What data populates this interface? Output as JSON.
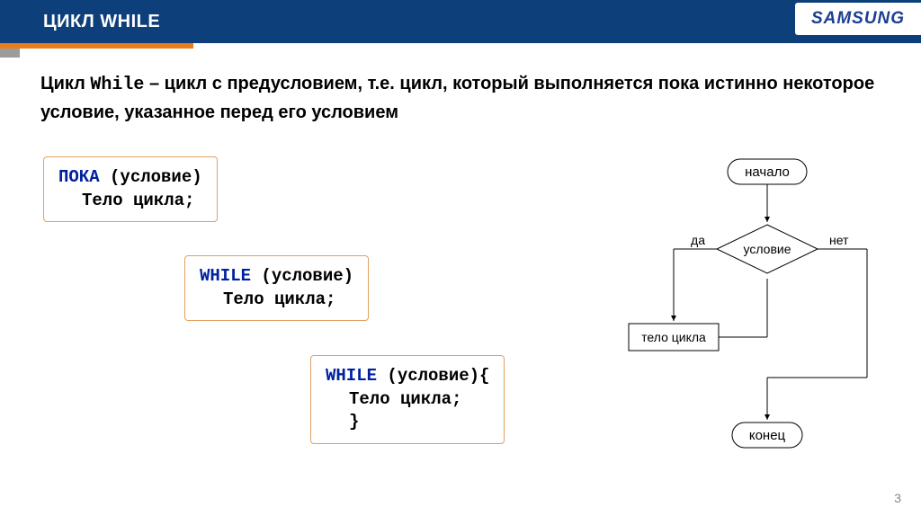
{
  "header": {
    "title": "ЦИКЛ WHILE",
    "brand": "SAMSUNG"
  },
  "description": {
    "prefix": "Цикл ",
    "mono": "While",
    "rest": " – цикл с предусловием, т.е. цикл, который выполняется пока истинно некоторое условие, указанное перед его условием"
  },
  "code_blocks": {
    "b1": {
      "kw": "ПОКА",
      "cond": " (условие)",
      "body": "Тело цикла;"
    },
    "b2": {
      "kw": "WHILE",
      "cond": " (условие)",
      "body": "Тело цикла;"
    },
    "b3": {
      "kw": "WHILE",
      "cond": " (условие){",
      "body": "Тело цикла;",
      "close": "}"
    }
  },
  "flowchart": {
    "start": "начало",
    "condition": "условие",
    "yes": "да",
    "no": "нет",
    "body": "тело цикла",
    "end": "конец"
  },
  "page_number": "3"
}
